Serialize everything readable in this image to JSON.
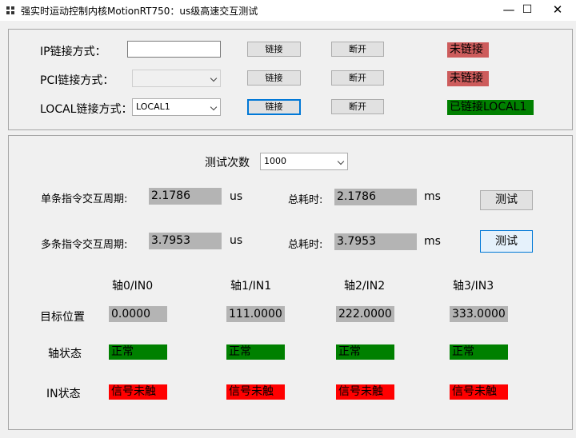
{
  "window": {
    "title": "强实时运动控制内核MotionRT750：us级高速交互测试",
    "min_glyph": "—",
    "max_glyph": "☐",
    "close_glyph": "✕"
  },
  "connection": {
    "rows": [
      {
        "label": "IP链接方式：",
        "input_value": "",
        "connect_label": "链接",
        "disconnect_label": "断开",
        "status": "未链接",
        "status_color": "#cd5c5c"
      },
      {
        "label": "PCI链接方式：",
        "combo_value": "",
        "connect_label": "链接",
        "disconnect_label": "断开",
        "status": "未链接",
        "status_color": "#cd5c5c"
      },
      {
        "label": "LOCAL链接方式：",
        "combo_value": "LOCAL1",
        "connect_label": "链接",
        "disconnect_label": "断开",
        "status": "已链接LOCAL1",
        "status_color": "#008000"
      }
    ]
  },
  "test": {
    "count_label": "测试次数",
    "count_value": "1000",
    "single": {
      "label": "单条指令交互周期:",
      "value": "2.1786",
      "unit": "us",
      "total_label": "总耗时:",
      "total_value": "2.1786",
      "total_unit": "ms",
      "button": "测试"
    },
    "multi": {
      "label": "多条指令交互周期:",
      "value": "3.7953",
      "unit": "us",
      "total_label": "总耗时:",
      "total_value": "3.7953",
      "total_unit": "ms",
      "button": "测试"
    }
  },
  "axes": {
    "row_labels": {
      "target": "目标位置",
      "axis_state": "轴状态",
      "in_state": "IN状态"
    },
    "columns": [
      {
        "header": "轴0/IN0",
        "target": "0.0000",
        "axis_state": "正常",
        "in_state": "信号未触"
      },
      {
        "header": "轴1/IN1",
        "target": "111.0000",
        "axis_state": "正常",
        "in_state": "信号未触"
      },
      {
        "header": "轴2/IN2",
        "target": "222.0000",
        "axis_state": "正常",
        "in_state": "信号未触"
      },
      {
        "header": "轴3/IN3",
        "target": "333.0000",
        "axis_state": "正常",
        "in_state": "信号未触"
      }
    ],
    "colors": {
      "normal": "#008000",
      "signal_off": "#ff0000"
    }
  }
}
